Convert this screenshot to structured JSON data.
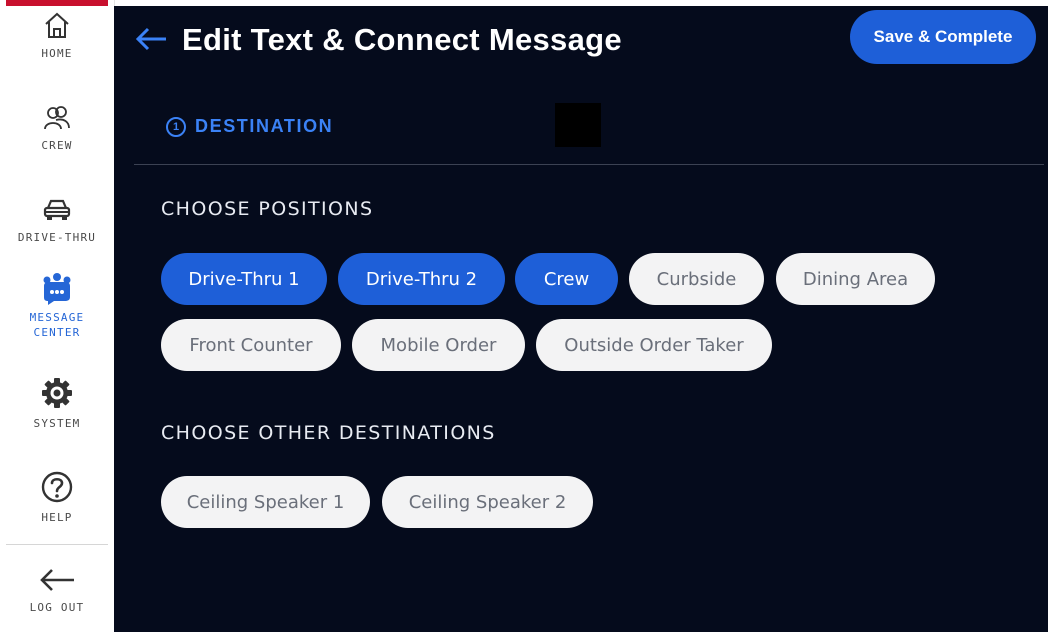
{
  "sidebar": {
    "items": [
      {
        "label": "HOME",
        "icon": "home-icon"
      },
      {
        "label": "CREW",
        "icon": "crew-icon"
      },
      {
        "label": "DRIVE-THRU",
        "icon": "car-icon"
      },
      {
        "label": "MESSAGE\nCENTER",
        "icon": "message-center-icon",
        "active": true
      },
      {
        "label": "SYSTEM",
        "icon": "gear-icon"
      },
      {
        "label": "HELP",
        "icon": "help-icon"
      },
      {
        "label": "LOG OUT",
        "icon": "logout-arrow-icon"
      }
    ]
  },
  "header": {
    "title": "Edit Text & Connect Message",
    "save_label": "Save & Complete"
  },
  "step": {
    "number": "1",
    "label": "DESTINATION"
  },
  "positions": {
    "title": "CHOOSE POSITIONS",
    "chips": [
      {
        "label": "Drive-Thru 1",
        "selected": true
      },
      {
        "label": "Drive-Thru 2",
        "selected": true
      },
      {
        "label": "Crew",
        "selected": true
      },
      {
        "label": "Curbside",
        "selected": false
      },
      {
        "label": "Dining Area",
        "selected": false
      },
      {
        "label": "Front Counter",
        "selected": false
      },
      {
        "label": "Mobile Order",
        "selected": false
      },
      {
        "label": "Outside Order Taker",
        "selected": false
      }
    ]
  },
  "other": {
    "title": "CHOOSE OTHER DESTINATIONS",
    "chips": [
      {
        "label": "Ceiling Speaker 1",
        "selected": false
      },
      {
        "label": "Ceiling Speaker 2",
        "selected": false
      }
    ]
  },
  "colors": {
    "accent": "#1e5fd8",
    "background": "#050b1c",
    "brand_red": "#c8102e"
  }
}
